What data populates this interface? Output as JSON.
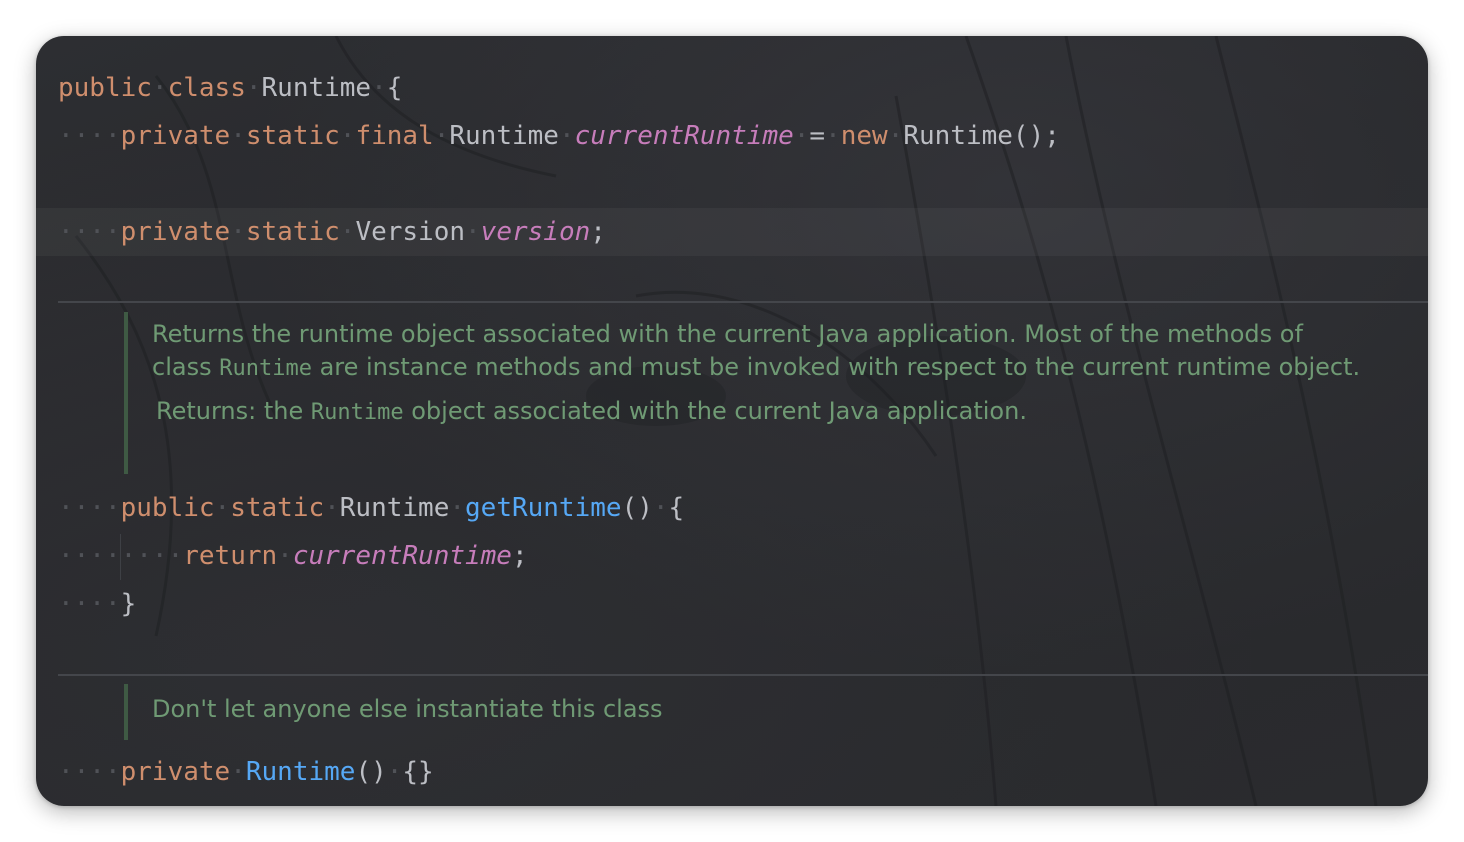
{
  "editor": {
    "lines": {
      "class_decl": {
        "kw_public": "public",
        "kw_class": "class",
        "name": "Runtime",
        "brace": "{"
      },
      "field_current": {
        "kw_private": "private",
        "kw_static": "static",
        "kw_final": "final",
        "type": "Runtime",
        "name": "currentRuntime",
        "eq": "=",
        "kw_new": "new",
        "ctor_call": "Runtime();"
      },
      "field_version": {
        "kw_private": "private",
        "kw_static": "static",
        "type": "Version",
        "name": "version",
        "semicolon": ";"
      },
      "method_get": {
        "kw_public": "public",
        "kw_static": "static",
        "type": "Runtime",
        "name": "getRuntime",
        "parens": "()",
        "brace": "{"
      },
      "return_stmt": {
        "kw_return": "return",
        "name": "currentRuntime",
        "semicolon": ";"
      },
      "close_brace": "}",
      "ctor_decl": {
        "kw_private": "private",
        "name": "Runtime",
        "parens": "()",
        "body": "{}"
      }
    },
    "doc_get_runtime": {
      "text_part1": "Returns the runtime object associated with the current Java application. Most of the methods of class ",
      "code1": "Runtime",
      "text_part2": " are instance methods and must be invoked with respect to the current runtime object.",
      "returns_label": "Returns:",
      "returns_part1": " the ",
      "returns_code": "Runtime",
      "returns_part2": " object associated with the current Java application."
    },
    "doc_ctor": {
      "text": "Don't let anyone else instantiate this class"
    },
    "whitespace_dots": {
      "indent4": "····",
      "indent8": "········",
      "space": "·"
    },
    "colors": {
      "keyword": "#cf8e6d",
      "field": "#c77dbb",
      "method": "#56a8f5",
      "text": "#bcbec4",
      "doc": "#6f9a74",
      "background": "#2b2c30"
    }
  }
}
